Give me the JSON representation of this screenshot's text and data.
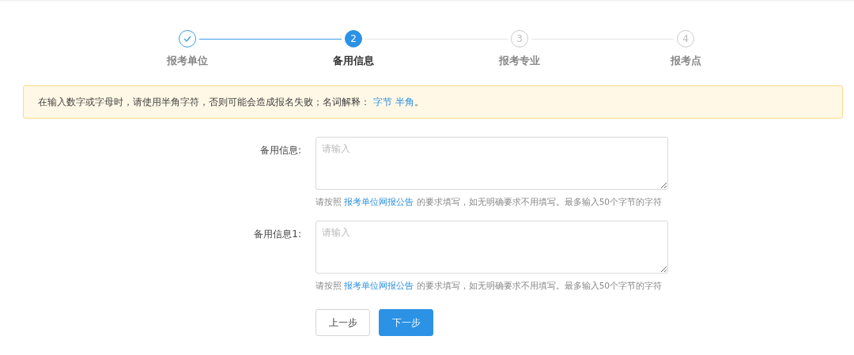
{
  "steps": [
    {
      "label": "报考单位",
      "completed": true,
      "selected": false
    },
    {
      "number": "2",
      "label": "备用信息",
      "completed": false,
      "selected": true
    },
    {
      "number": "3",
      "label": "报考专业",
      "completed": false,
      "selected": false
    },
    {
      "number": "4",
      "label": "报考点",
      "completed": false,
      "selected": false
    }
  ],
  "notice": {
    "text": "在输入数字或字母时，请使用半角字符，否则可能会造成报名失败；名词解释：",
    "links": [
      "字节",
      "半角"
    ],
    "end": "。"
  },
  "fields": [
    {
      "label": "备用信息:",
      "placeholder": "请输入",
      "hint": {
        "before": "请按照",
        "link": "报考单位网报公告",
        "after": "的要求填写，如无明确要求不用填写。最多输入50个字节的字符"
      }
    },
    {
      "label": "备用信息1:",
      "placeholder": "请输入",
      "hint": {
        "before": "请按照",
        "link": "报考单位网报公告",
        "after": "的要求填写，如无明确要求不用填写。最多输入50个字节的字符"
      }
    }
  ],
  "buttons": [
    {
      "label": "上一步",
      "kind": "default"
    },
    {
      "label": "下一步",
      "kind": "primary"
    }
  ]
}
